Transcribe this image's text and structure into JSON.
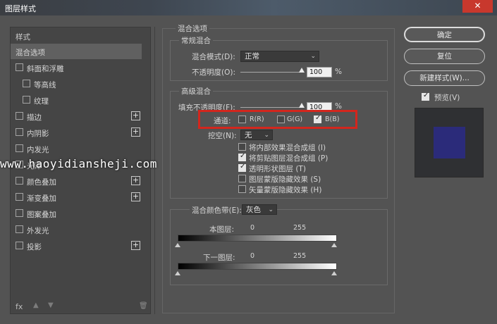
{
  "window": {
    "title": "图层样式",
    "close": "✕"
  },
  "left": {
    "header": "样式",
    "items": [
      {
        "label": "混合选项"
      },
      {
        "label": "斜面和浮雕"
      },
      {
        "label": "等高线"
      },
      {
        "label": "纹理"
      },
      {
        "label": "描边",
        "plus": "+"
      },
      {
        "label": "内阴影",
        "plus": "+"
      },
      {
        "label": "内发光"
      },
      {
        "label": "光泽"
      },
      {
        "label": "颜色叠加",
        "plus": "+"
      },
      {
        "label": "渐变叠加",
        "plus": "+"
      },
      {
        "label": "图案叠加"
      },
      {
        "label": "外发光"
      },
      {
        "label": "投影",
        "plus": "+"
      }
    ],
    "fx": "fx",
    "up": "▲",
    "down": "▼",
    "trash": "🗑"
  },
  "main": {
    "section_title": "混合选项",
    "general": {
      "title": "常规混合",
      "mode_label": "混合模式(D):",
      "mode_value": "正常",
      "opacity_label": "不透明度(O):",
      "opacity_value": "100",
      "opacity_unit": "%",
      "opacity_level": 1.0
    },
    "advanced": {
      "title": "高级混合",
      "fill_label": "填充不透明度(F):",
      "fill_value": "100",
      "fill_unit": "%",
      "channels_label": "通道:",
      "channel_r": "R(R)",
      "channel_g": "G(G)",
      "channel_b": "B(B)",
      "channel_r_checked": false,
      "channel_g_checked": false,
      "channel_b_checked": true,
      "knockout_label": "挖空(N):",
      "knockout_value": "无",
      "options": [
        {
          "label": "将内部效果混合成组 (I)",
          "checked": false
        },
        {
          "label": "将剪贴图层混合成组 (P)",
          "checked": true
        },
        {
          "label": "透明形状图层 (T)",
          "checked": true
        },
        {
          "label": "图层蒙版隐藏效果 (S)",
          "checked": false
        },
        {
          "label": "矢量蒙版隐藏效果 (H)",
          "checked": false
        }
      ]
    },
    "blend_if": {
      "label": "混合颜色带(E):",
      "value": "灰色",
      "this_layer": "本图层:",
      "this_min": "0",
      "this_max": "255",
      "under_layer": "下一图层:",
      "under_min": "0",
      "under_max": "255"
    }
  },
  "buttons": {
    "ok": "确定",
    "reset": "复位",
    "new_style": "新建样式(W)...",
    "preview_label": "预览(V)",
    "preview_checked": true
  },
  "preview_color": "#2b2b7a",
  "highlight_color": "#d3261d",
  "watermark": "www.haoyidiansheji.com"
}
